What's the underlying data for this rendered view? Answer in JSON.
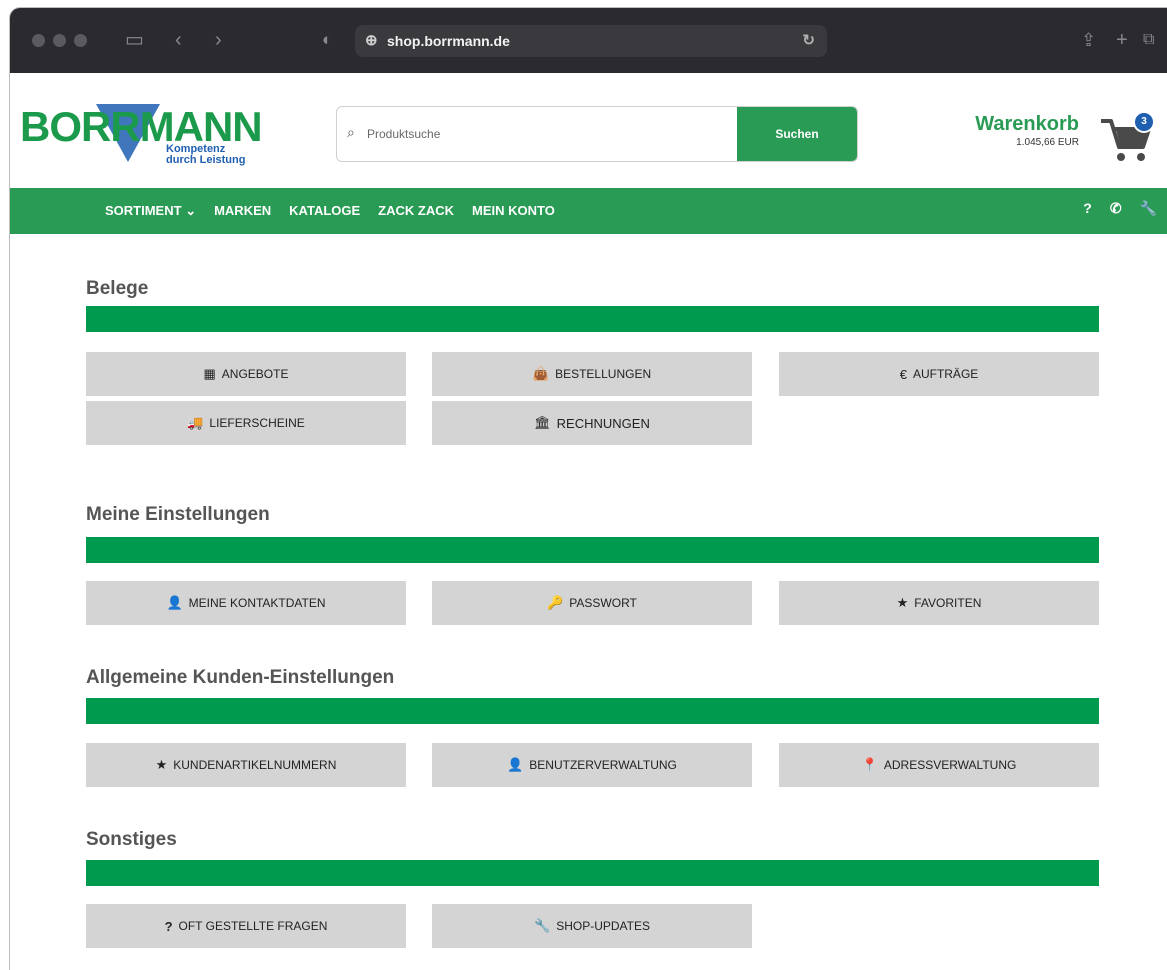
{
  "browser": {
    "url": "shop.borrmann.de"
  },
  "header": {
    "logo_word": "BORRMANN",
    "logo_tag_line1": "Kompetenz",
    "logo_tag_line2": "durch Leistung",
    "search_placeholder": "Produktsuche",
    "search_button": "Suchen",
    "cart_title": "Warenkorb",
    "cart_value": "1.045,66 EUR",
    "cart_count": "3"
  },
  "nav": {
    "items": [
      "SORTIMENT",
      "MARKEN",
      "KATALOGE",
      "ZACK ZACK",
      "MEIN KONTO"
    ]
  },
  "sections": [
    {
      "title": "Belege",
      "tiles": [
        {
          "label": "ANGEBOTE",
          "icon": "calculator-icon",
          "glyph": "▦"
        },
        {
          "label": "BESTELLUNGEN",
          "icon": "shopping-bag-icon",
          "glyph": "👜"
        },
        {
          "label": "AUFTRÄGE",
          "icon": "euro-icon",
          "glyph": "€"
        },
        {
          "label": "LIEFERSCHEINE",
          "icon": "truck-icon",
          "glyph": "🚚"
        },
        {
          "label": "RECHNUNGEN",
          "icon": "bank-icon",
          "glyph": "🏛"
        }
      ]
    },
    {
      "title": "Meine Einstellungen",
      "tiles": [
        {
          "label": "MEINE KONTAKTDATEN",
          "icon": "user-icon",
          "glyph": "👤"
        },
        {
          "label": "PASSWORT",
          "icon": "key-icon",
          "glyph": "🔑"
        },
        {
          "label": "FAVORITEN",
          "icon": "star-icon",
          "glyph": "★"
        }
      ]
    },
    {
      "title": "Allgemeine Kunden-Einstellungen",
      "tiles": [
        {
          "label": "KUNDENARTIKELNUMMERN",
          "icon": "star-icon",
          "glyph": "★"
        },
        {
          "label": "BENUTZERVERWALTUNG",
          "icon": "user-icon",
          "glyph": "👤"
        },
        {
          "label": "ADRESSVERWALTUNG",
          "icon": "map-marker-icon",
          "glyph": "📍"
        }
      ]
    },
    {
      "title": "Sonstiges",
      "tiles": [
        {
          "label": "OFT GESTELLTE FRAGEN",
          "icon": "question-icon",
          "glyph": "?"
        },
        {
          "label": "SHOP-UPDATES",
          "icon": "wrench-icon",
          "glyph": "🔧"
        }
      ]
    }
  ]
}
